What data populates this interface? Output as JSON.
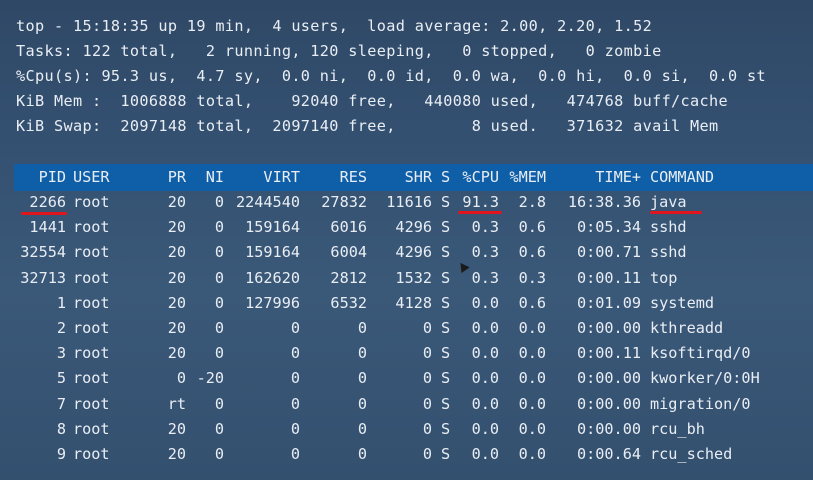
{
  "summary": {
    "line1": "top - 15:18:35 up 19 min,  4 users,  load average: 2.00, 2.20, 1.52",
    "line2": "Tasks: 122 total,   2 running, 120 sleeping,   0 stopped,   0 zombie",
    "line3": "%Cpu(s): 95.3 us,  4.7 sy,  0.0 ni,  0.0 id,  0.0 wa,  0.0 hi,  0.0 si,  0.0 st",
    "line4": "KiB Mem :  1006888 total,    92040 free,   440080 used,   474768 buff/cache",
    "line5": "KiB Swap:  2097148 total,  2097140 free,        8 used.   371632 avail Mem"
  },
  "columns": [
    "PID",
    "USER",
    "PR",
    "NI",
    "VIRT",
    "RES",
    "SHR",
    "S",
    "%CPU",
    "%MEM",
    "TIME+",
    "COMMAND"
  ],
  "processes": [
    {
      "pid": "2266",
      "user": "root",
      "pr": "20",
      "ni": "0",
      "virt": "2244540",
      "res": "27832",
      "shr": "11616",
      "s": "S",
      "cpu": "91.3",
      "mem": "2.8",
      "time": "16:38.36",
      "cmd": "java"
    },
    {
      "pid": "1441",
      "user": "root",
      "pr": "20",
      "ni": "0",
      "virt": "159164",
      "res": "6016",
      "shr": "4296",
      "s": "S",
      "cpu": "0.3",
      "mem": "0.6",
      "time": "0:05.34",
      "cmd": "sshd"
    },
    {
      "pid": "32554",
      "user": "root",
      "pr": "20",
      "ni": "0",
      "virt": "159164",
      "res": "6004",
      "shr": "4296",
      "s": "S",
      "cpu": "0.3",
      "mem": "0.6",
      "time": "0:00.71",
      "cmd": "sshd"
    },
    {
      "pid": "32713",
      "user": "root",
      "pr": "20",
      "ni": "0",
      "virt": "162620",
      "res": "2812",
      "shr": "1532",
      "s": "S",
      "cpu": "0.3",
      "mem": "0.3",
      "time": "0:00.11",
      "cmd": "top"
    },
    {
      "pid": "1",
      "user": "root",
      "pr": "20",
      "ni": "0",
      "virt": "127996",
      "res": "6532",
      "shr": "4128",
      "s": "S",
      "cpu": "0.0",
      "mem": "0.6",
      "time": "0:01.09",
      "cmd": "systemd"
    },
    {
      "pid": "2",
      "user": "root",
      "pr": "20",
      "ni": "0",
      "virt": "0",
      "res": "0",
      "shr": "0",
      "s": "S",
      "cpu": "0.0",
      "mem": "0.0",
      "time": "0:00.00",
      "cmd": "kthreadd"
    },
    {
      "pid": "3",
      "user": "root",
      "pr": "20",
      "ni": "0",
      "virt": "0",
      "res": "0",
      "shr": "0",
      "s": "S",
      "cpu": "0.0",
      "mem": "0.0",
      "time": "0:00.11",
      "cmd": "ksoftirqd/0"
    },
    {
      "pid": "5",
      "user": "root",
      "pr": "0",
      "ni": "-20",
      "virt": "0",
      "res": "0",
      "shr": "0",
      "s": "S",
      "cpu": "0.0",
      "mem": "0.0",
      "time": "0:00.00",
      "cmd": "kworker/0:0H"
    },
    {
      "pid": "7",
      "user": "root",
      "pr": "rt",
      "ni": "0",
      "virt": "0",
      "res": "0",
      "shr": "0",
      "s": "S",
      "cpu": "0.0",
      "mem": "0.0",
      "time": "0:00.00",
      "cmd": "migration/0"
    },
    {
      "pid": "8",
      "user": "root",
      "pr": "20",
      "ni": "0",
      "virt": "0",
      "res": "0",
      "shr": "0",
      "s": "S",
      "cpu": "0.0",
      "mem": "0.0",
      "time": "0:00.00",
      "cmd": "rcu_bh"
    },
    {
      "pid": "9",
      "user": "root",
      "pr": "20",
      "ni": "0",
      "virt": "0",
      "res": "0",
      "shr": "0",
      "s": "S",
      "cpu": "0.0",
      "mem": "0.0",
      "time": "0:00.64",
      "cmd": "rcu_sched"
    }
  ],
  "colors": {
    "header_bar": "#0f5fa8",
    "annotation": "#e0161e",
    "text": "#e9eef4"
  }
}
